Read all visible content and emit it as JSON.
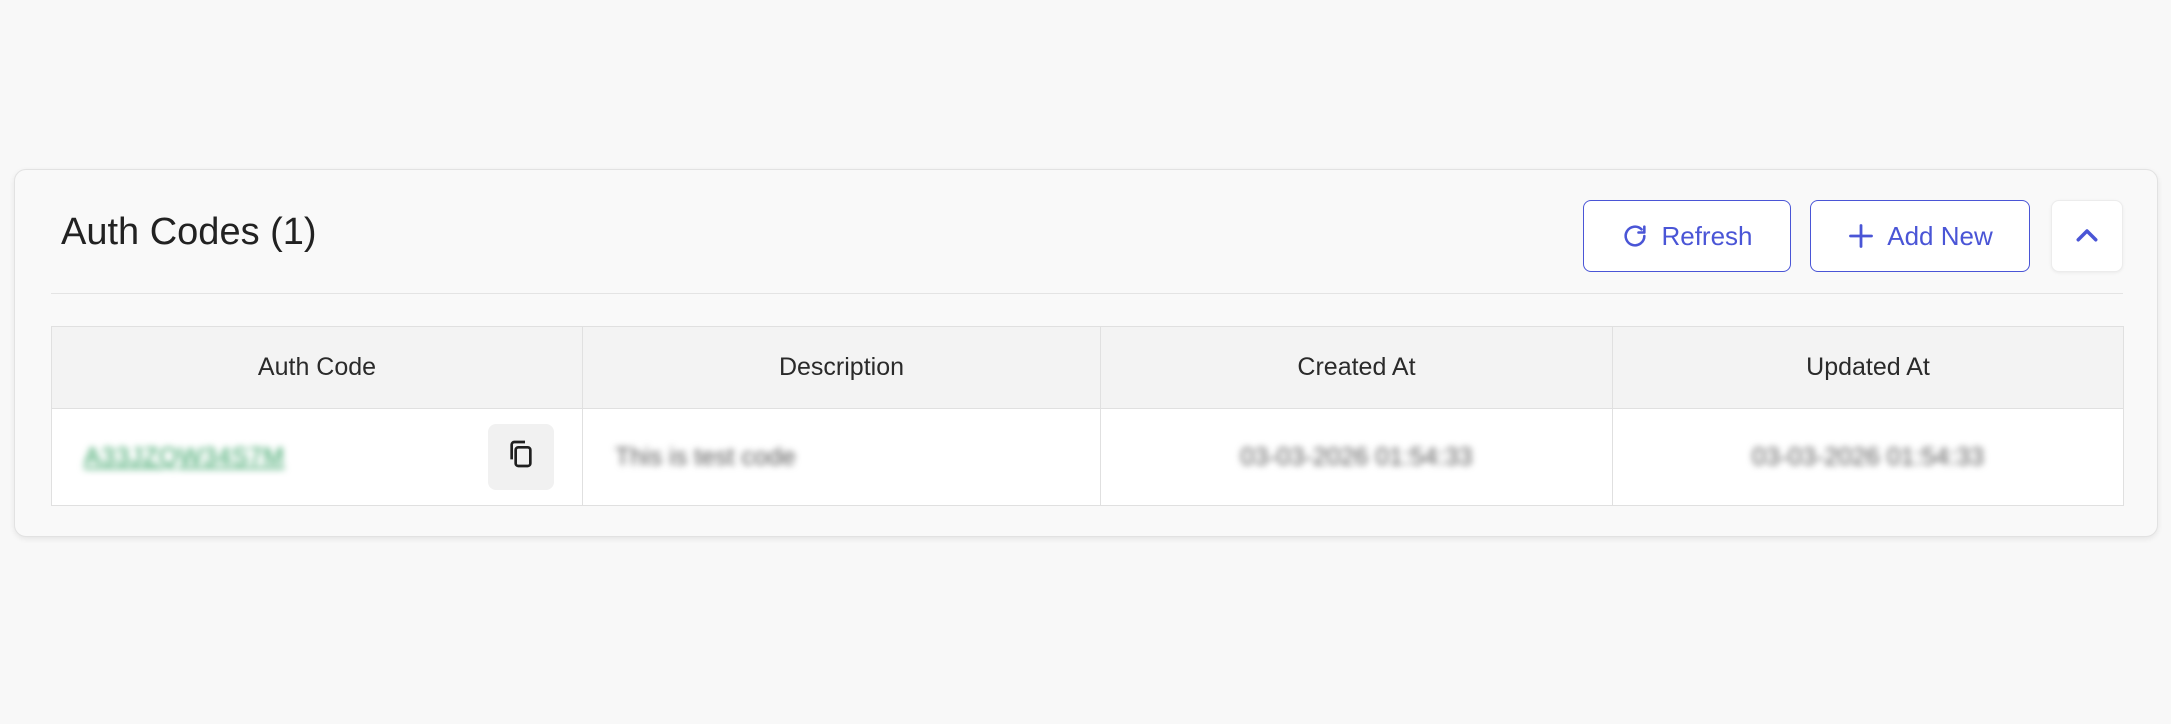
{
  "panel": {
    "title": "Auth Codes (1)"
  },
  "toolbar": {
    "refresh_label": "Refresh",
    "refresh_icon": "refresh-icon",
    "add_label": "Add New",
    "add_icon": "plus-icon",
    "collapse_icon": "chevron-up-icon"
  },
  "colors": {
    "accent": "#4a55d6",
    "code_link": "#2e9e5e"
  },
  "table": {
    "columns": [
      "Auth Code",
      "Description",
      "Created At",
      "Updated At"
    ],
    "rows": [
      {
        "auth_code": "A33JZQW34S7M",
        "copy_icon": "copy-icon",
        "description": "This is test code",
        "created_at": "03-03-2026 01:54:33",
        "updated_at": "03-03-2026 01:54:33"
      }
    ]
  }
}
